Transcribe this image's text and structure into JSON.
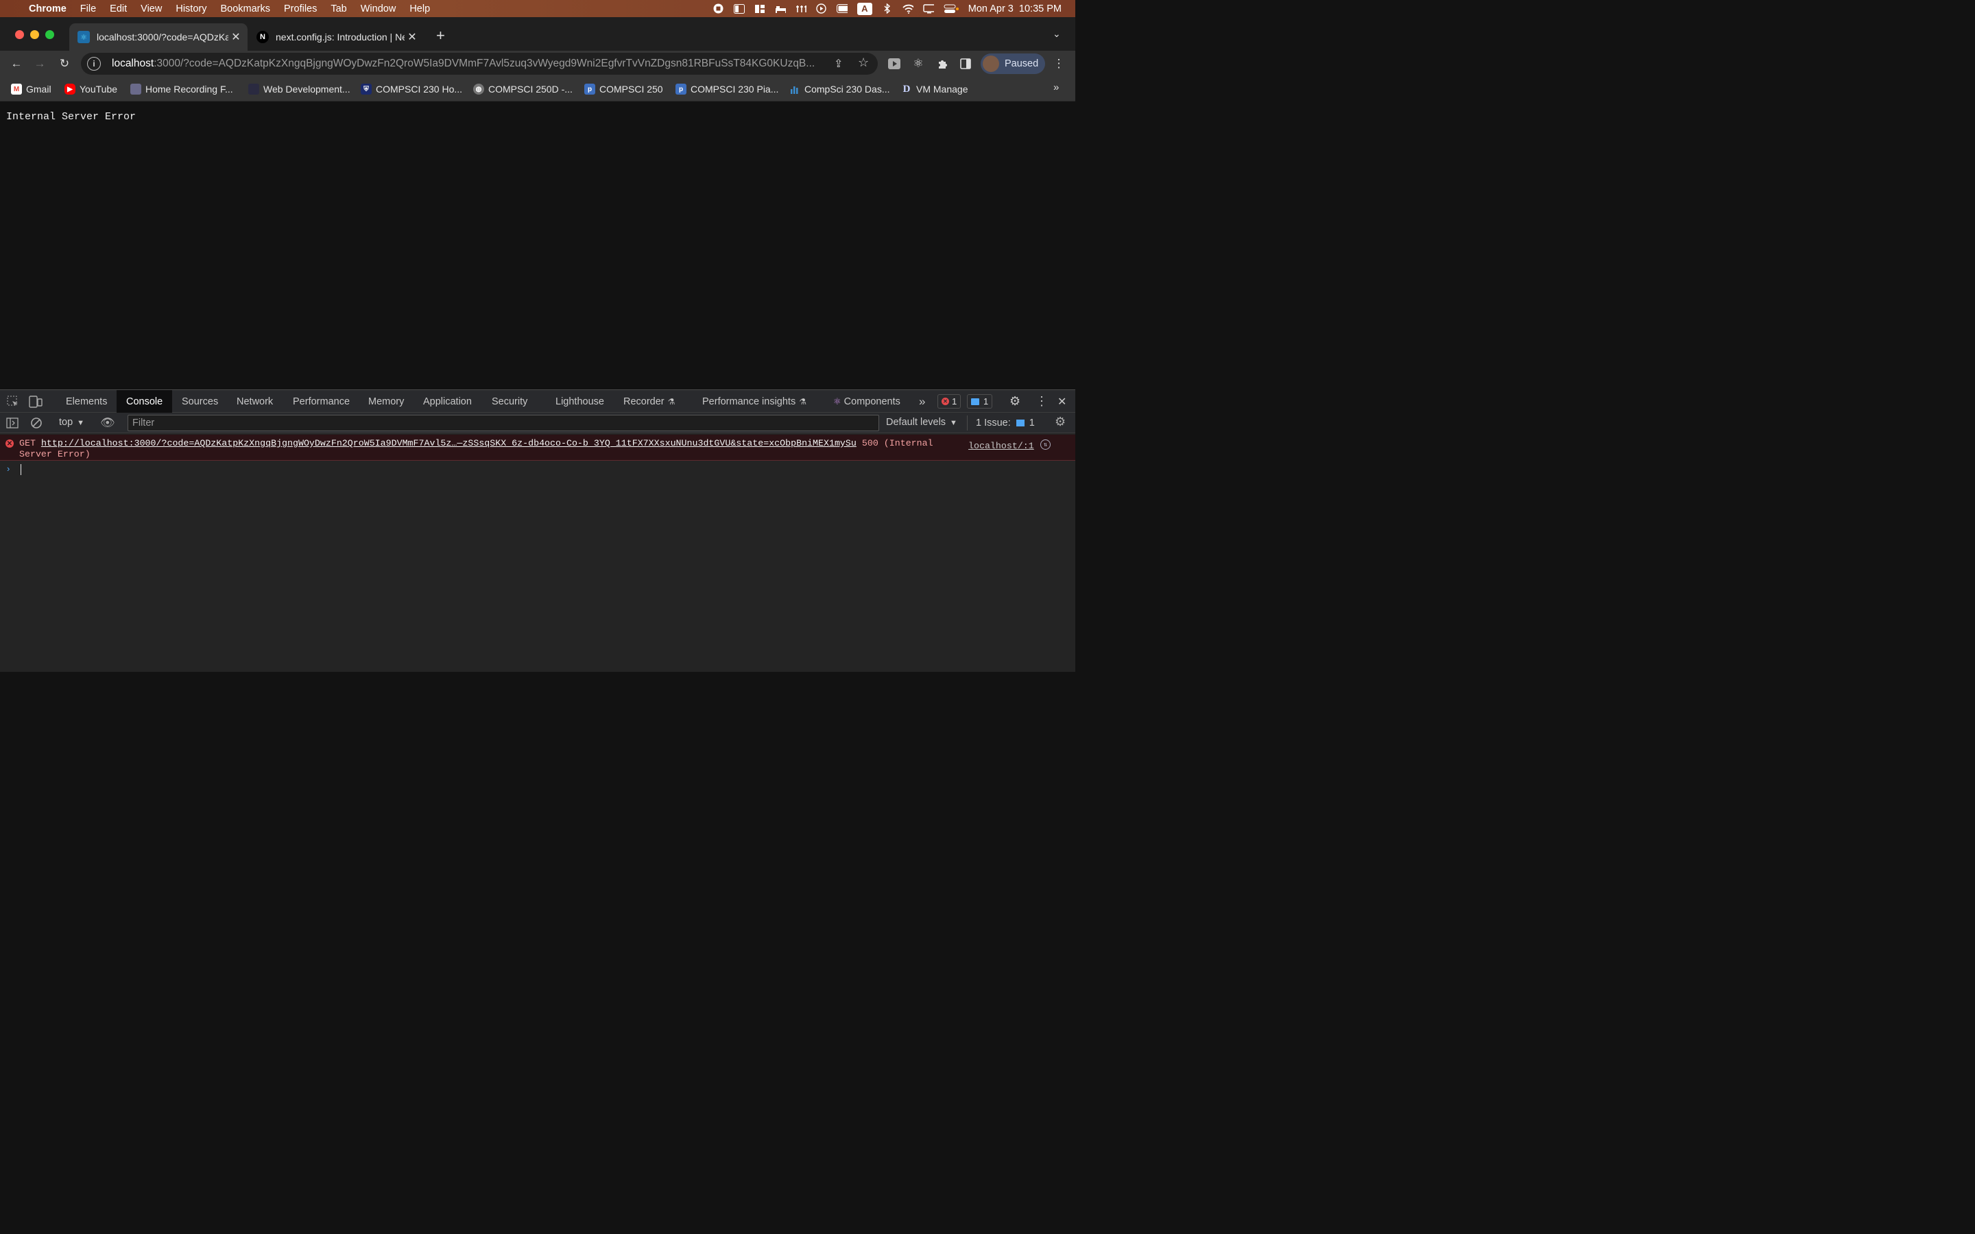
{
  "menubar": {
    "items": [
      "Chrome",
      "File",
      "Edit",
      "View",
      "History",
      "Bookmarks",
      "Profiles",
      "Tab",
      "Window",
      "Help"
    ],
    "status_icons": [
      "record-icon",
      "sidebar-icon",
      "layout-icon",
      "bed-icon",
      "network-icon",
      "play-icon",
      "battery-icon",
      "keyboard-input-icon",
      "bluetooth-icon",
      "wifi-icon",
      "display-icon",
      "control-center-icon"
    ],
    "input_source": "A",
    "clock": "Mon Apr 3  10:35 PM"
  },
  "tabs": [
    {
      "title": "localhost:3000/?code=AQDzKa",
      "favicon": "react-icon",
      "active": true
    },
    {
      "title": "next.config.js: Introduction | Ne",
      "favicon": "nextjs-icon",
      "active": false
    }
  ],
  "toolbar": {
    "url_host": "localhost",
    "url_rest": ":3000/?code=AQDzKatpKzXngqBjgngWOyDwzFn2QroW5Ia9DVMmF7Avl5zuq3vWyegd9Wni2EgfvrTvVnZDgsn81RBFuSsT84KG0KUzqB...",
    "profile_label": "Paused"
  },
  "bookmarks": [
    {
      "label": "Gmail",
      "icon": "gmail-icon",
      "color": "#ea4335"
    },
    {
      "label": "YouTube",
      "icon": "youtube-icon",
      "color": "#ff0000"
    },
    {
      "label": "Home Recording F...",
      "icon": "forum-icon",
      "color": "#6a6a8a"
    },
    {
      "label": "Web Development...",
      "icon": "blank-icon",
      "color": "#2a2a40"
    },
    {
      "label": "COMPSCI 230 Ho...",
      "icon": "shield-icon",
      "color": "#1b2a6b"
    },
    {
      "label": "COMPSCI 250D -...",
      "icon": "globe-icon",
      "color": "#777777"
    },
    {
      "label": "COMPSCI 250",
      "icon": "piazza-icon",
      "color": "#3e6fbf"
    },
    {
      "label": "COMPSCI 230 Pia...",
      "icon": "piazza-icon",
      "color": "#3e6fbf"
    },
    {
      "label": "CompSci 230 Das...",
      "icon": "bar-chart-icon",
      "color": "#3b8ed1"
    },
    {
      "label": "VM Manage",
      "icon": "duke-d-icon",
      "color": "#1b2a6b"
    }
  ],
  "page": {
    "message": "Internal Server Error"
  },
  "devtools": {
    "tabs": [
      "Elements",
      "Console",
      "Sources",
      "Network",
      "Performance",
      "Memory",
      "Application",
      "Security",
      "Lighthouse",
      "Recorder",
      "Performance insights",
      "Components"
    ],
    "selected_tab": "Console",
    "error_count": "1",
    "message_count": "1",
    "context": "top",
    "filter_placeholder": "Filter",
    "levels": "Default levels",
    "issues_label": "1 Issue:",
    "issues_count": "1"
  },
  "console": {
    "method": "GET",
    "url": "http://localhost:3000/?code=AQDzKatpKzXngqBjgngWOyDwzFn2QroW5Ia9DVMmF7Avl5z…—zSSsqSKX_6z-db4oco-Co-b_3YQ_11tFX7XXsxuNUnu3dtGVU&state=xcObpBniMEX1mySu",
    "status": "500 (Internal",
    "status_cont": "Server Error)",
    "source": "localhost/:1"
  },
  "colors": {
    "menubar": "#7a3a22",
    "error_bg": "#2b1316",
    "error_icon": "#e4484b",
    "accent": "#4fa6f5"
  }
}
